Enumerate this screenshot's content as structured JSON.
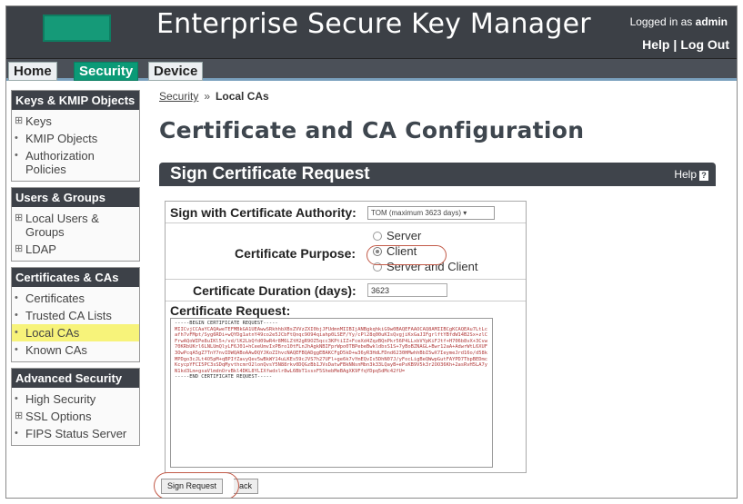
{
  "header": {
    "title": "Enterprise Secure Key Manager",
    "logged_in_prefix": "Logged in as",
    "user": "admin",
    "help": "Help",
    "logout": "Log Out",
    "separator": "|",
    "logo_color": "#159a78"
  },
  "tabs": [
    {
      "label": "Home",
      "active": false
    },
    {
      "label": "Security",
      "active": true
    },
    {
      "label": "Device",
      "active": false
    }
  ],
  "sidebar": {
    "groups": [
      {
        "title": "Keys & KMIP Objects",
        "items": [
          {
            "label": "Keys",
            "bullet": "⊞"
          },
          {
            "label": "KMIP Objects",
            "bullet": "•"
          },
          {
            "label": "Authorization Policies",
            "bullet": "•"
          }
        ]
      },
      {
        "title": "Users & Groups",
        "items": [
          {
            "label": "Local Users & Groups",
            "bullet": "⊞"
          },
          {
            "label": "LDAP",
            "bullet": "⊞"
          }
        ]
      },
      {
        "title": "Certificates & CAs",
        "items": [
          {
            "label": "Certificates",
            "bullet": "•"
          },
          {
            "label": "Trusted CA Lists",
            "bullet": "•"
          },
          {
            "label": "Local CAs",
            "bullet": "•",
            "selected": true
          },
          {
            "label": "Known CAs",
            "bullet": "•"
          }
        ]
      },
      {
        "title": "Advanced Security",
        "items": [
          {
            "label": "High Security",
            "bullet": "•"
          },
          {
            "label": "SSL Options",
            "bullet": "⊞"
          },
          {
            "label": "FIPS Status Server",
            "bullet": "•"
          }
        ]
      }
    ]
  },
  "breadcrumb": {
    "parent": "Security",
    "arrow": "»",
    "current": "Local CAs"
  },
  "page_title": "Certificate and CA Configuration",
  "section": {
    "title": "Sign Certificate Request",
    "help": "Help",
    "help_icon": "?"
  },
  "form": {
    "ca_label": "Sign with Certificate Authority:",
    "ca_value": "TOM (maximum 3623 days) ▾",
    "purpose_label": "Certificate Purpose:",
    "purpose_options": [
      {
        "label": "Server",
        "selected": false
      },
      {
        "label": "Client",
        "selected": true
      },
      {
        "label": "Server and Client",
        "selected": false
      }
    ],
    "duration_label": "Certificate Duration (days):",
    "duration_value": "3623",
    "request_label": "Certificate Request:",
    "request_begin": "-----BEGIN CERTIFICATE REQUEST-----",
    "request_body": "MIICvjCCAaYCAQAweTEFMBkGA1UEAwwSRkhhbXBsZVVzZXI0bjJFUdmnMIIBIjANBgkqhkiG9w0BAQEFAAOCAQ8AMIIBCgKCAQEAu7LtLcafh7vFMpt/Syg6RDi+wQYDg1atnY49co2e5JCbFtQnqc9O94qiahp0LSEF/Yy/cPl28q00uKIsQvgjiKxGaJIFgrlftYBfdW14B2Sx+zlCFrwAQoWIPe8uIKl5+/vd/lK2LbQfd09wR4r8M6LZtH2gR9OZ5qcc3KPtiIZ+FceXd4ZqzBQnPkr56P4LLxbVYpKiFJtf+H706b8vX+3Cvw70KRbUKrl6LNLUmQlyLF6J01+hCeeUmvIxPBro10tFLnJhAgkNBIFprWpo0TBPebeBwkldbsS1S+7yBoBZNAGL+Bwr12aA+AdwrWtL6XUF3OwPcqA5gZ7TnY7nvIDWQABoAAwDQYJKoZIhvcNAQEFBQADggEBAKCFgD5kD+w36yR3HdLFDnd6230HMwhhBbI5wX7IeymeJrd16o/d58kMPDgo3cJLt4O5pM+qBPIfZavyQev5wBkWY14uLKEs59cJVS7h27UFl+ge6k7vYmEQvIs5DhN07J/yFocLigBeQWwpGutFAYPD7TbpBEDmcKcycpYFCI5PC3sSDqMyvthcmrO2lonQvsY5N88rkv0DQGzBb1JVsDatwFBkNNsnMbn3k33LQayB+ePsKB9V5k3r2OO36Kh+2asRvH5LA7yN1kd3Lm+gsaVlmdnOrvBkl4DKL8YLIXfwdxlr8wL6BbT1ssxF5ShebMeBAgXK9FfqYDpq5dMc42fU=",
    "request_end": "-----END CERTIFICATE REQUEST-----",
    "sign_button": "Sign Request",
    "back_button": "ack"
  }
}
